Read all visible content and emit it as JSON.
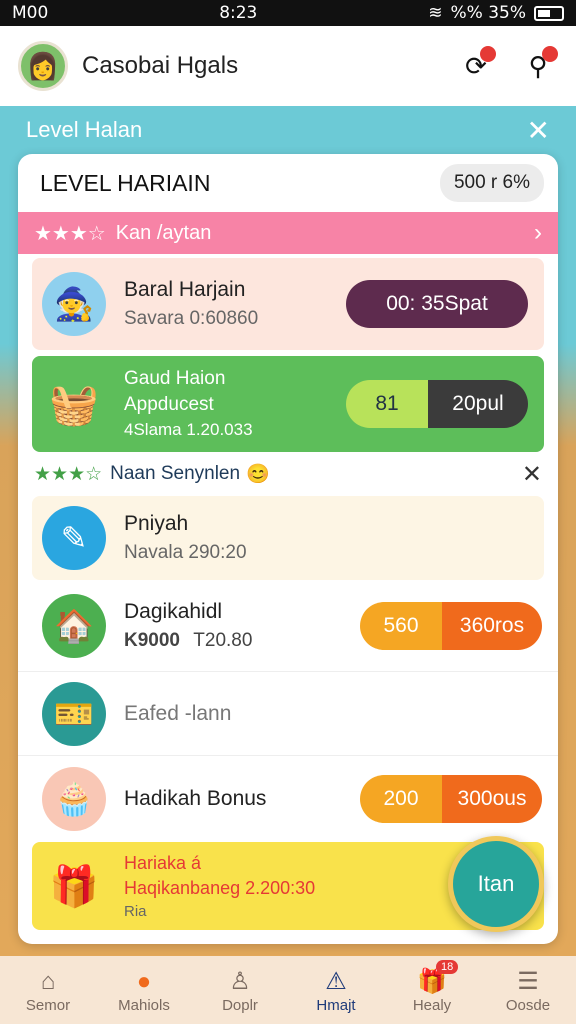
{
  "status_bar": {
    "left": "M00",
    "time": "8:23",
    "battery_text": "%% 35%"
  },
  "app_bar": {
    "title": "Casobai Hgals",
    "avatar_icon": "girl-avatar"
  },
  "modal": {
    "header_title": "Level Halan"
  },
  "panel": {
    "title": "LEVEL HARIAIN",
    "badge": "500 r 6%",
    "strip_stars": "★★★☆",
    "strip_label": "Kan /aytan"
  },
  "rows": [
    {
      "title": "Baral Harjain",
      "subtitle": "Savara 0:60860",
      "button": "00: 35Spat",
      "icon": "gnome-icon"
    },
    {
      "title_lines": [
        "Gaud Haion",
        "Appducest",
        "4Slama 1.20.033"
      ],
      "btn_a": "81",
      "btn_b": "20pul",
      "icon": "treasure-basket-icon"
    },
    {
      "title": "Pniyah",
      "subtitle": "Navala 290:20",
      "icon": "pencil-icon"
    },
    {
      "title": "Dagikahidl",
      "subtitle_strong": "K9000",
      "subtitle": "T20.80",
      "btn_a": "560",
      "btn_b": "360ros",
      "icon": "building-icon"
    },
    {
      "title": "Eafed -lann",
      "icon": "ticket-icon"
    },
    {
      "title": "Hadikah Bonus",
      "btn_a": "200",
      "btn_b": "300ous",
      "icon": "cupcake-icon"
    },
    {
      "title_lines": [
        "Hariaka á",
        "Haqikanbaneg 2.200:30",
        "Ria"
      ],
      "icon": "gift-bag-icon"
    }
  ],
  "rating_row": {
    "stars": "★★★☆",
    "label": "Naan Senynlen",
    "emoji": "😊"
  },
  "fab": {
    "label": "Itan"
  },
  "bottom_nav": [
    {
      "label": "Semor",
      "icon": "home-icon"
    },
    {
      "label": "Mahiols",
      "icon": "orange-icon"
    },
    {
      "label": "Doplr",
      "icon": "person-icon"
    },
    {
      "label": "Hmajt",
      "icon": "warning-icon"
    },
    {
      "label": "Healy",
      "icon": "gift-icon",
      "badge": "18"
    },
    {
      "label": "Oosde",
      "icon": "menu-icon"
    }
  ],
  "colors": {
    "accent_pink": "#f783a6",
    "purple_button": "#5e2b4e",
    "orange": "#f5a623",
    "green_card": "#5dbe5a",
    "teal": "#27a59a"
  }
}
